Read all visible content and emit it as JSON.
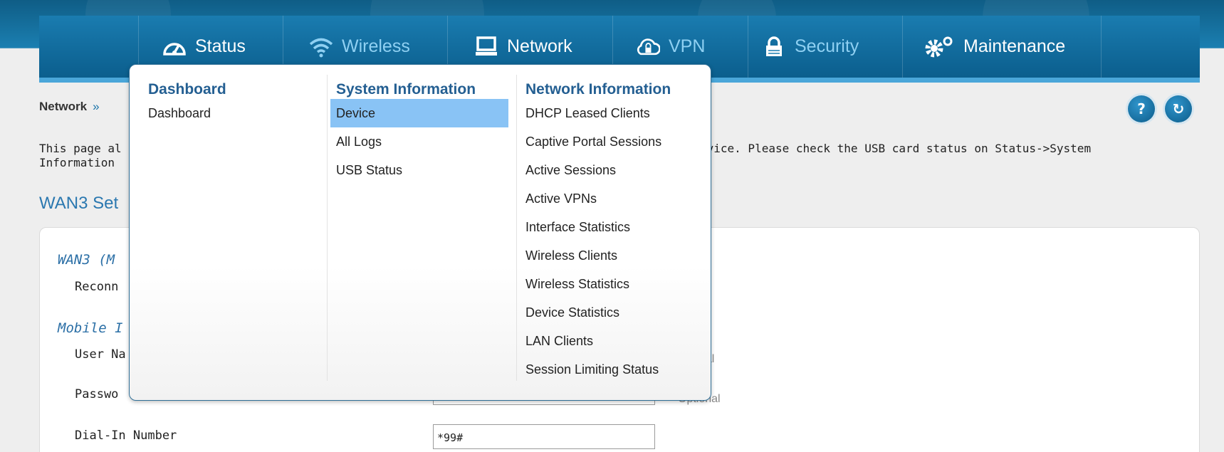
{
  "nav": {
    "items": [
      {
        "label": "Status",
        "icon": "gauge-icon"
      },
      {
        "label": "Wireless",
        "icon": "wifi-icon"
      },
      {
        "label": "Network",
        "icon": "monitor-icon"
      },
      {
        "label": "VPN",
        "icon": "cloud-lock-icon"
      },
      {
        "label": "Security",
        "icon": "padlock-icon"
      },
      {
        "label": "Maintenance",
        "icon": "gears-icon"
      }
    ]
  },
  "breadcrumb": {
    "item": "Network",
    "separator": "»"
  },
  "header_buttons": {
    "help": "?",
    "refresh": "↻"
  },
  "page": {
    "description_line1": "This page al",
    "description_line1_right": "rvice. Please check the USB card status on Status->System",
    "description_line2": "Information",
    "heading": "WAN3 Set"
  },
  "form": {
    "section1_title": "WAN3 (M",
    "reconnect_label": "Reconn",
    "section2_title": "Mobile I",
    "username_label": "User Na",
    "username_hint": "nal",
    "password_label": "Passwo",
    "password_hint": "Optional",
    "dialin_label": "Dial-In Number",
    "dialin_value": "*99#"
  },
  "dropdown": {
    "columns": [
      {
        "heading": "Dashboard",
        "items": [
          "Dashboard"
        ]
      },
      {
        "heading": "System Information",
        "items": [
          "Device",
          "All Logs",
          "USB Status"
        ],
        "selected": "Device"
      },
      {
        "heading": "Network Information",
        "items": [
          "DHCP Leased Clients",
          "Captive Portal Sessions",
          "Active Sessions",
          "Active VPNs",
          "Interface Statistics",
          "Wireless Clients",
          "Wireless Statistics",
          "Device Statistics",
          "LAN Clients",
          "Session Limiting Status"
        ]
      }
    ]
  },
  "colors": {
    "nav_bg": "#1a7cb0",
    "accent": "#2b78b0",
    "selected": "#89c3f5"
  }
}
